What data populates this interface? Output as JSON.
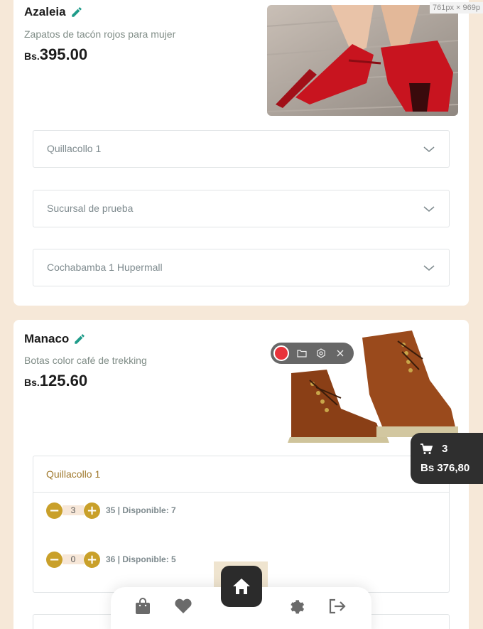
{
  "screen_dims": "761px × 969p",
  "products": [
    {
      "brand": "Azaleia",
      "description": "Zapatos de tacón rojos para mujer",
      "currency": "Bs.",
      "price": "395.00",
      "branches": [
        "Quillacollo 1",
        "Sucursal de prueba",
        "Cochabamba 1 Hupermall"
      ]
    },
    {
      "brand": "Manaco",
      "description": "Botas color café de trekking",
      "currency": "Bs.",
      "price": "125.60",
      "open_branch": "Quillacollo 1",
      "sizes": [
        {
          "qty": "3",
          "label": "35 | Disponible: 7"
        },
        {
          "qty": "0",
          "label": "36 | Disponible: 5"
        }
      ]
    }
  ],
  "cart": {
    "count": "3",
    "total": "Bs 376,80"
  },
  "recorder": {
    "icons": [
      "record-icon",
      "folder-icon",
      "settings-icon",
      "close-icon"
    ]
  },
  "nav": {
    "items": [
      "bag-icon",
      "heart-icon",
      "home-icon",
      "gear-icon",
      "logout-icon"
    ]
  },
  "colors": {
    "accent": "#c9a02a",
    "brand_green": "#1f9c8a",
    "background": "#f6e8d8",
    "dark": "#2b2b2b"
  }
}
